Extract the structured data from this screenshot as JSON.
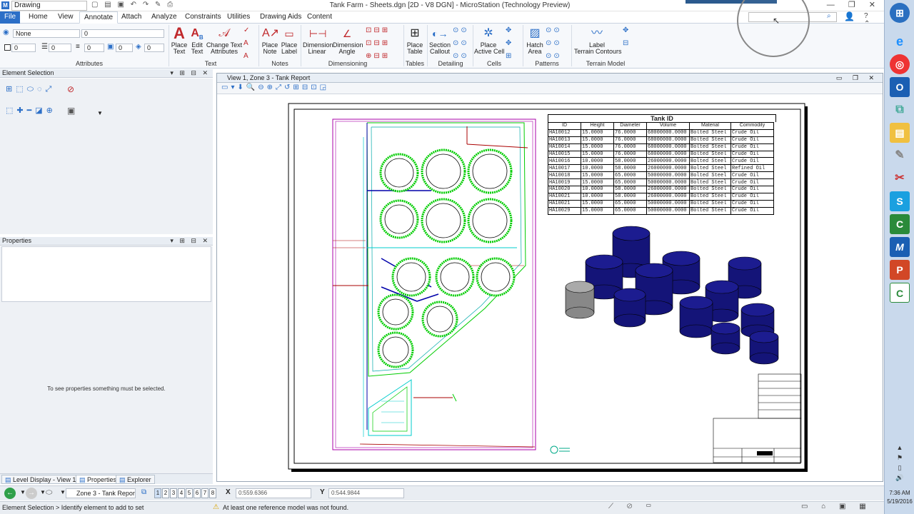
{
  "app": {
    "workspace": "Drawing",
    "window_title": "Tank Farm - Sheets.dgn [2D - V8 DGN] - MicroStation (Technology Preview)"
  },
  "menu": {
    "tabs": [
      "File",
      "Home",
      "View",
      "Annotate",
      "Attach",
      "Analyze",
      "Constraints",
      "Utilities",
      "Drawing Aids",
      "Content"
    ],
    "active": "Annotate"
  },
  "ribbon": {
    "attributes": {
      "level": "None",
      "style": "0",
      "color": "0",
      "weight": "0",
      "fill": "0",
      "transparency": "0",
      "priority": "0",
      "label": "Attributes"
    },
    "text": {
      "label": "Text",
      "place_text": "Place\nText",
      "edit_text": "Edit\nText",
      "change_text_attributes": "Change Text\nAttributes"
    },
    "notes": {
      "label": "Notes",
      "place_note": "Place\nNote",
      "place_label": "Place\nLabel"
    },
    "dimensioning": {
      "label": "Dimensioning",
      "dimension_linear": "Dimension\nLinear",
      "dimension_angle": "Dimension\nAngle"
    },
    "tables": {
      "label": "Tables",
      "place_table": "Place\nTable"
    },
    "detailing": {
      "label": "Detailing",
      "section_callout": "Section\nCallout"
    },
    "cells": {
      "label": "Cells",
      "place_active_cell": "Place\nActive Cell"
    },
    "patterns": {
      "label": "Patterns",
      "hatch_area": "Hatch\nArea"
    },
    "terrain": {
      "label": "Terrain Model",
      "label_terrain_contours": "Label\nTerrain Contours"
    }
  },
  "panels": {
    "element_selection": {
      "title": "Element Selection"
    },
    "properties": {
      "title": "Properties",
      "empty_message": "To see properties something must be selected."
    }
  },
  "view": {
    "title": "View 1, Zone 3 - Tank Report"
  },
  "tank_table": {
    "title": "Tank ID",
    "columns": [
      "ID",
      "Height",
      "Diameter",
      "Volume",
      "Material",
      "Commodity"
    ],
    "rows": [
      [
        "HA10012",
        "15.0000",
        "76.0000",
        "68000000.0000",
        "Bolted Steel",
        "Crude Oil"
      ],
      [
        "HA10013",
        "15.0000",
        "76.0000",
        "68000000.0000",
        "Bolted Steel",
        "Crude Oil"
      ],
      [
        "HA10014",
        "15.0000",
        "76.0000",
        "68000000.0000",
        "Bolted Steel",
        "Crude Oil"
      ],
      [
        "HA10015",
        "15.0000",
        "76.0000",
        "68000000.0000",
        "Bolted Steel",
        "Crude Oil"
      ],
      [
        "HA10016",
        "10.0000",
        "58.0000",
        "26000000.0000",
        "Bolted Steel",
        "Crude Oil"
      ],
      [
        "HA10017",
        "10.0000",
        "58.0000",
        "26000000.0000",
        "Bolted Steel",
        "Refined Oil"
      ],
      [
        "HA10018",
        "15.0000",
        "65.0000",
        "50000000.0000",
        "Bolted Steel",
        "Crude Oil"
      ],
      [
        "HA10019",
        "15.0000",
        "65.0000",
        "50000000.0000",
        "Bolted Steel",
        "Crude Oil"
      ],
      [
        "HA10020",
        "10.0000",
        "58.0000",
        "26000000.0000",
        "Bolted Steel",
        "Crude Oil"
      ],
      [
        "HA10021",
        "10.0000",
        "58.0000",
        "26000000.0000",
        "Bolted Steel",
        "Crude Oil"
      ],
      [
        "HA10021",
        "15.0000",
        "65.0000",
        "50000000.0000",
        "Bolted Steel",
        "Crude Oil"
      ],
      [
        "HA10029",
        "15.0000",
        "65.0000",
        "50000000.0000",
        "Bolted Steel",
        "Crude Oil"
      ]
    ]
  },
  "bottom_tabs": [
    "Level Display - View 1",
    "Properties",
    "Explorer"
  ],
  "status": {
    "view_selector": "Zone 3 - Tank Repor",
    "view_numbers": [
      "1",
      "2",
      "3",
      "4",
      "5",
      "6",
      "7",
      "8"
    ],
    "x_label": "X",
    "x_value": "0:559.6366",
    "y_label": "Y",
    "y_value": "0:544.9844",
    "prompt": "Element Selection > Identify element to add to set",
    "warning": "At least one reference model was not found."
  },
  "clock": {
    "time": "7:36 AM",
    "date": "5/19/2016"
  }
}
